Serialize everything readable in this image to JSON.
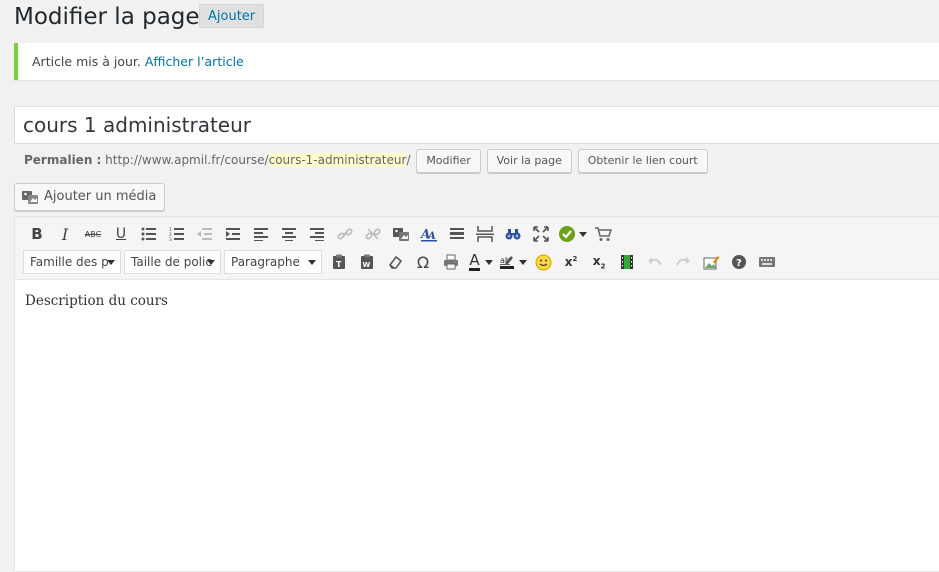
{
  "header": {
    "title": "Modifier la page",
    "add_label": "Ajouter"
  },
  "notice": {
    "message": "Article mis à jour.",
    "link": "Afficher l’article",
    "accent_color": "#7ad03a"
  },
  "post": {
    "title": "cours 1 administrateur",
    "content": "Description du cours"
  },
  "permalink": {
    "label": "Permalien :",
    "base": "http://www.apmil.fr/course/",
    "slug": "cours-1-administrateur",
    "trailing": "/",
    "edit_button": "Modifier",
    "view_button": "Voir la page",
    "shortlink_button": "Obtenir le lien court"
  },
  "media": {
    "add_label": "Ajouter un média"
  },
  "toolbar": {
    "font_family": "Famille des p",
    "font_size": "Taille de polic",
    "format": "Paragraphe",
    "row1_icons": [
      "bold-icon",
      "italic-icon",
      "strikethrough-icon",
      "underline-icon",
      "bullet-list-icon",
      "numbered-list-icon",
      "outdent-icon",
      "indent-icon",
      "align-left-icon",
      "align-center-icon",
      "align-right-icon",
      "link-icon",
      "unlink-icon",
      "insert-media-icon",
      "anchor-icon",
      "horizontal-line-icon",
      "page-break-icon",
      "find-replace-icon",
      "fullscreen-icon",
      "check-circle-icon",
      "cart-icon"
    ],
    "row2_icons": [
      "paste-text-icon",
      "paste-word-icon",
      "clear-formatting-icon",
      "omega-icon",
      "print-icon",
      "text-color-icon",
      "highlight-color-icon",
      "emoticon-icon",
      "superscript-icon",
      "subscript-icon",
      "film-icon",
      "undo-icon",
      "redo-icon",
      "edit-image-icon",
      "help-icon",
      "keyboard-icon"
    ]
  }
}
